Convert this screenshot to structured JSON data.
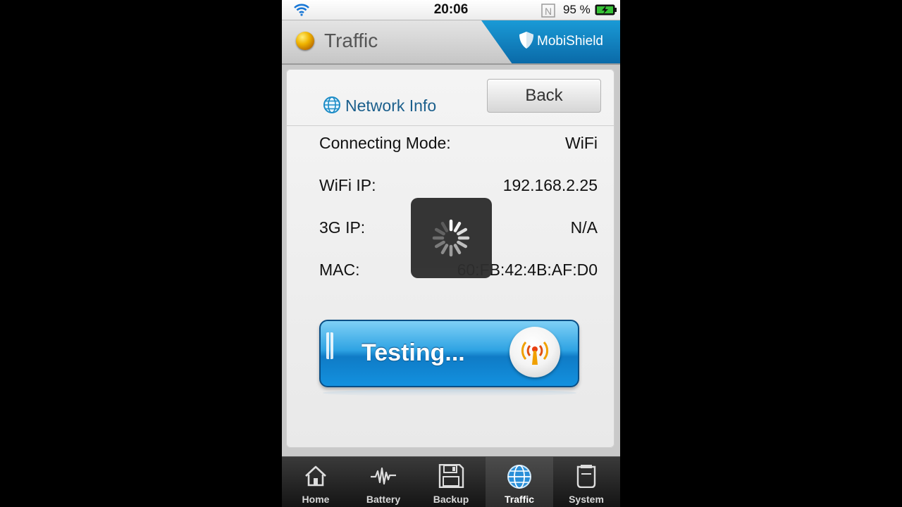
{
  "status_bar": {
    "time": "20:06",
    "battery_percent": "95 %",
    "icons": [
      "wifi-signal-icon",
      "nfc-icon",
      "battery-charging-icon"
    ]
  },
  "header": {
    "title": "Traffic",
    "brand": "MobiShield"
  },
  "network_info": {
    "title": "Network Info",
    "back_label": "Back",
    "rows": [
      {
        "label": "Connecting Mode:",
        "value": "WiFi"
      },
      {
        "label": "WiFi IP:",
        "value": "192.168.2.25"
      },
      {
        "label": "3G IP:",
        "value": "N/A"
      },
      {
        "label": "MAC:",
        "value": "60:FB:42:4B:AF:D0"
      }
    ]
  },
  "test_button": {
    "label": "Testing..."
  },
  "tabs": [
    {
      "label": "Home",
      "icon": "home-icon"
    },
    {
      "label": "Battery",
      "icon": "pulse-icon"
    },
    {
      "label": "Backup",
      "icon": "floppy-disk-icon"
    },
    {
      "label": "Traffic",
      "icon": "globe-icon",
      "active": true
    },
    {
      "label": "System",
      "icon": "phone-icon"
    }
  ],
  "colors": {
    "accent_blue": "#1391df",
    "title_blue": "#1b5f8c",
    "brand_blue": "#0a6aa8"
  }
}
